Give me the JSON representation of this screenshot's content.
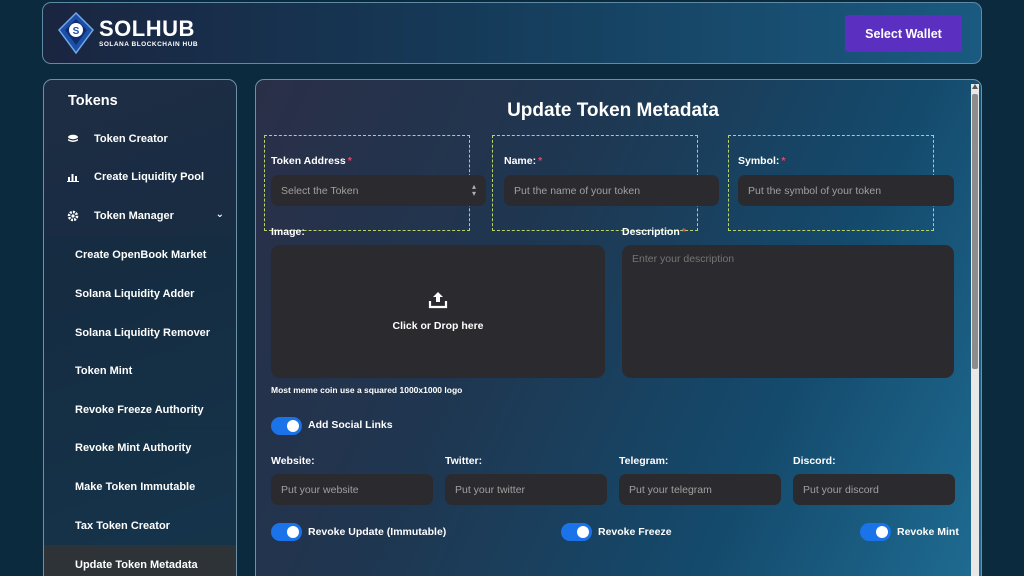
{
  "header": {
    "brand_title": "SOLHUB",
    "brand_subtitle": "SOLANA BLOCKCHAIN HUB",
    "wallet_button": "Select Wallet"
  },
  "sidebar": {
    "title": "Tokens",
    "items": [
      {
        "label": "Token Creator",
        "icon": "coins-icon"
      },
      {
        "label": "Create Liquidity Pool",
        "icon": "bar-chart-icon"
      },
      {
        "label": "Token Manager",
        "icon": "gear-icon"
      }
    ],
    "sub_items": [
      {
        "label": "Create OpenBook Market"
      },
      {
        "label": "Solana Liquidity Adder"
      },
      {
        "label": "Solana Liquidity Remover"
      },
      {
        "label": "Token Mint"
      },
      {
        "label": "Revoke Freeze Authority"
      },
      {
        "label": "Revoke Mint Authority"
      },
      {
        "label": "Make Token Immutable"
      },
      {
        "label": "Tax Token Creator"
      },
      {
        "label": "Update Token Metadata"
      }
    ]
  },
  "form": {
    "title": "Update Token Metadata",
    "token_address": {
      "label": "Token Address",
      "required": "*",
      "value": "Select the Token"
    },
    "name": {
      "label": "Name:",
      "required": "*",
      "placeholder": "Put the name of your token"
    },
    "symbol": {
      "label": "Symbol:",
      "required": "*",
      "placeholder": "Put the symbol of your token"
    },
    "image": {
      "label": "Image:",
      "dropzone_text": "Click or Drop here",
      "hint": "Most meme coin use a squared 1000x1000 logo"
    },
    "description": {
      "label": "Description",
      "required": "*",
      "placeholder": "Enter your description"
    },
    "social_toggle": {
      "label": "Add Social Links",
      "on": true
    },
    "website": {
      "label": "Website:",
      "placeholder": "Put your website"
    },
    "twitter": {
      "label": "Twitter:",
      "placeholder": "Put your twitter"
    },
    "telegram": {
      "label": "Telegram:",
      "placeholder": "Put your telegram"
    },
    "discord": {
      "label": "Discord:",
      "placeholder": "Put your discord"
    },
    "revoke_update": {
      "label": "Revoke Update (Immutable)",
      "on": true
    },
    "revoke_freeze": {
      "label": "Revoke Freeze",
      "on": true
    },
    "revoke_mint": {
      "label": "Revoke Mint",
      "on": true
    }
  },
  "colors": {
    "accent": "#5b2fc0",
    "toggle_on": "#1a73e8",
    "required": "#e04a6a",
    "field_bg": "#2b2b2f"
  }
}
